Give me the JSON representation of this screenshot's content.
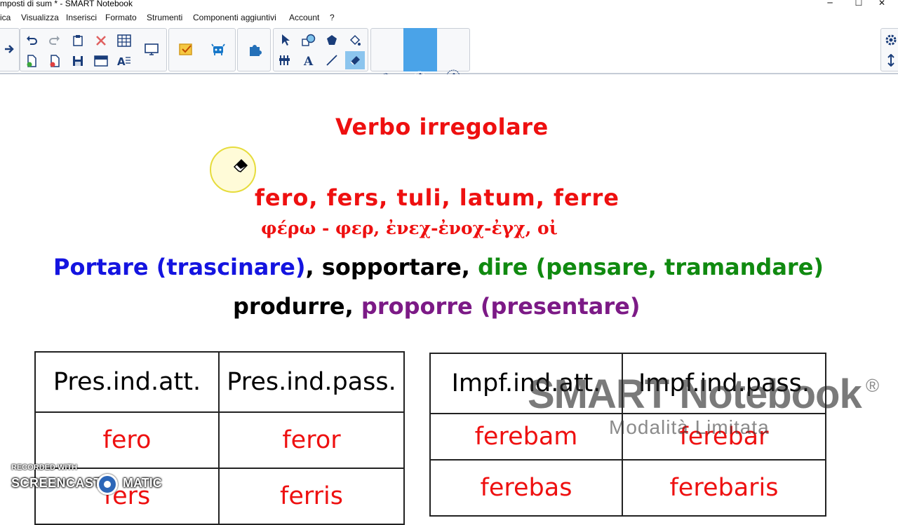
{
  "window": {
    "title": "mposti di sum * - SMART Notebook",
    "controls": [
      "─",
      "☐",
      "✕"
    ]
  },
  "menu": [
    "ica",
    "Visualizza",
    "Inserisci",
    "Formato",
    "Strumenti",
    "Componenti aggiuntivi",
    "Account",
    "?"
  ],
  "toolbar": {
    "icons": [
      "next-page-icon",
      "undo-icon",
      "redo-icon",
      "paste-icon",
      "delete-icon",
      "table-icon",
      "add-page-icon",
      "remove-page-icon",
      "save-icon",
      "screen-shade-icon",
      "spell-check-icon",
      "display-icon",
      "lesson-activity-icon",
      "response-icon",
      "addons-icon",
      "select-icon",
      "shapes-icon",
      "polygon-icon",
      "fill-icon",
      "measure-icon",
      "text-icon",
      "line-icon",
      "eraser-icon",
      "eraser-small-icon",
      "eraser-medium-icon",
      "eraser-large-icon",
      "settings-icon",
      "toolbar-move-icon"
    ],
    "active_tool": "eraser"
  },
  "canvas": {
    "heading": "Verbo irregolare",
    "latin_forms": "fero, fers, tuli, latum, ferre",
    "greek_roots": "φέρω - φερ, ἐνεχ-ἐνοχ-ἐγχ, οἰ",
    "meanings": {
      "m1": "Portare (trascinare)",
      "sep1": ", ",
      "m2": "sopportare",
      "sep2": ", ",
      "m3": "dire (pensare, tramandare)"
    },
    "meanings2": {
      "m4": "produrre",
      "sep": ", ",
      "m5": "proporre (presentare)"
    },
    "colors": {
      "red": "#ee1010",
      "blue": "#1414e0",
      "black": "#000000",
      "green": "#108a10",
      "purple": "#7c1a86"
    }
  },
  "table_left": {
    "headers": [
      "Pres.ind.att.",
      "Pres.ind.pass."
    ],
    "rows": [
      [
        "fero",
        "feror"
      ],
      [
        "fers",
        "ferris"
      ]
    ]
  },
  "table_right": {
    "headers": [
      "Impf.ind.att.",
      "Impf.ind.pass."
    ],
    "rows": [
      [
        "ferebam",
        "ferebar"
      ],
      [
        "ferebas",
        "ferebaris"
      ]
    ]
  },
  "watermarks": {
    "smart": "SMART Notebook",
    "registered": "®",
    "mode": "Modalità Limitata",
    "recorder_small": "RECORDED WITH",
    "recorder_left": "SCREENCAST",
    "recorder_right": "MATIC"
  }
}
